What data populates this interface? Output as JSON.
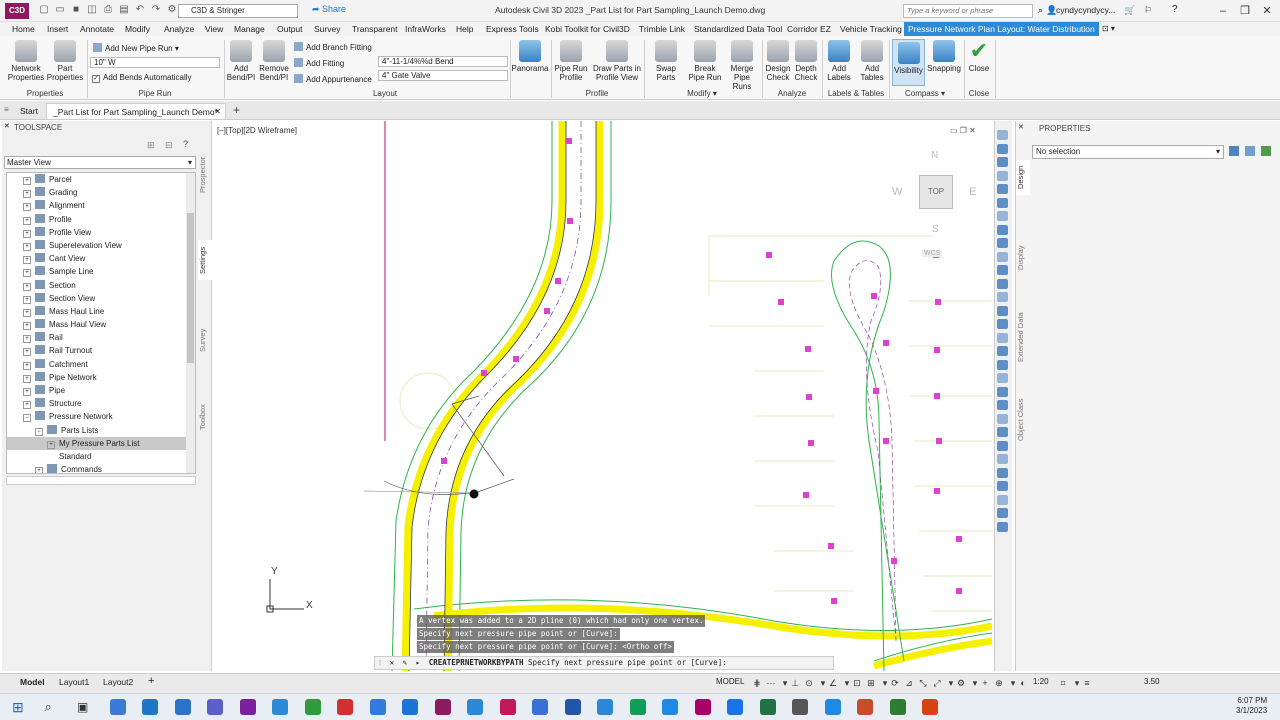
{
  "titlebar": {
    "app_badge": "C3D",
    "workspace": "C3D & Stringer",
    "share": "Share",
    "window_title": "Autodesk Civil 3D 2023   _Part List for Part Sampling_Launch Demo.dwg",
    "search_placeholder": "Type a keyword or phrase",
    "user": "cyndycyndycy...",
    "help": "?",
    "minimize": "–",
    "maximize": "❐",
    "close": "✕"
  },
  "menu_tabs": [
    "Home",
    "Insert",
    "Annotate",
    "Modify",
    "Analyze",
    "View",
    "Manage",
    "Output",
    "Survey",
    "Transparent",
    "InfraWorks",
    "Help",
    "Express Tools",
    "Kobi Toolkit for Civil3D",
    "Trimble Link",
    "Standardized Data Tool",
    "Corridor EZ",
    "Vehicle Tracking",
    "Pressure Network Plan Layout: Water Distribution"
  ],
  "ribbon": {
    "network_properties": "Network Properties",
    "part_properties": "Part Properties",
    "properties_panel": "Properties",
    "add_new_pipe_run": "Add New Pipe Run",
    "pipe_size": "10\" W",
    "add_bends_auto": "Add Bends Automatically",
    "pipe_run_panel": "Pipe Run",
    "add_bend_pi": "Add Bend/PI",
    "remove_bend_pi": "Remove Bend/PI",
    "add_branch_fitting": "Add Branch Fitting",
    "add_fitting": "Add Fitting",
    "add_appurtenance": "Add Appurtenance",
    "fitting_value": "4\"-11-1/4%%d Bend",
    "appurtenance_value": "4\" Gate Valve",
    "layout_panel": "Layout",
    "panorama": "Panorama",
    "pipe_run_profile": "Pipe Run Profile",
    "draw_parts_profile": "Draw Parts in Profile View",
    "profile_panel": "Profile",
    "swap_parts": "Swap Parts",
    "break_pipe_run": "Break Pipe Run",
    "merge_pipe_runs": "Merge Pipe Runs",
    "modify_panel": "Modify",
    "design_check": "Design Check",
    "depth_check": "Depth Check",
    "analyze_panel": "Analyze",
    "add_labels": "Add Labels",
    "add_tables": "Add Tables",
    "labels_tables_panel": "Labels & Tables",
    "visibility": "Visibility",
    "snapping": "Snapping",
    "compass_panel": "Compass",
    "close": "Close",
    "close_panel": "Close"
  },
  "doc_tabs": {
    "start": "Start",
    "active": "_Part List for Part Sampling_Launch Demo*",
    "close": "✕",
    "add": "+"
  },
  "toolspace": {
    "title": "TOOLSPACE",
    "view": "Master View",
    "items": [
      {
        "label": "Parcel",
        "indent": 1
      },
      {
        "label": "Grading",
        "indent": 1
      },
      {
        "label": "Alignment",
        "indent": 1
      },
      {
        "label": "Profile",
        "indent": 1
      },
      {
        "label": "Profile View",
        "indent": 1
      },
      {
        "label": "Superelevation View",
        "indent": 1
      },
      {
        "label": "Cant View",
        "indent": 1
      },
      {
        "label": "Sample Line",
        "indent": 1
      },
      {
        "label": "Section",
        "indent": 1
      },
      {
        "label": "Section View",
        "indent": 1
      },
      {
        "label": "Mass Haul Line",
        "indent": 1
      },
      {
        "label": "Mass Haul View",
        "indent": 1
      },
      {
        "label": "Rail",
        "indent": 1
      },
      {
        "label": "Rail Turnout",
        "indent": 1
      },
      {
        "label": "Catchment",
        "indent": 1
      },
      {
        "label": "Pipe Network",
        "indent": 1
      },
      {
        "label": "Pipe",
        "indent": 1
      },
      {
        "label": "Structure",
        "indent": 1
      },
      {
        "label": "Pressure Network",
        "indent": 1
      },
      {
        "label": "Parts Lists",
        "indent": 2
      },
      {
        "label": "My Pressure Parts List",
        "indent": 3
      },
      {
        "label": "Standard",
        "indent": 3
      },
      {
        "label": "Commands",
        "indent": 2
      }
    ],
    "side_tabs": [
      "Prospector",
      "Settings",
      "Survey",
      "Toolbox"
    ]
  },
  "viewport": {
    "label": "[–][Top][2D Wireframe]",
    "compass": {
      "n": "N",
      "s": "S",
      "e": "E",
      "w": "W",
      "top": "TOP",
      "wcs": "WCS"
    },
    "ucs_x": "X",
    "ucs_y": "Y"
  },
  "command": {
    "history": [
      "A vertex was added to a 2D pline (0) which had only one vertex.",
      "Specify next pressure pipe point or [Curve]:",
      "Specify next pressure pipe point or [Curve]:  <Ortho off>"
    ],
    "current_command": "CREATEPRNETWORKBYPATH",
    "prompt": "Specify next pressure pipe point or [Curve]:"
  },
  "properties": {
    "title": "PROPERTIES",
    "selection": "No selection",
    "side_tabs": [
      "Design",
      "Display",
      "Extended Data",
      "Object Class"
    ]
  },
  "status": {
    "layout_tabs": [
      "Model",
      "Layout1",
      "Layout2"
    ],
    "add_tab": "+",
    "model": "MODEL",
    "scale": "1:20",
    "value": "3.50"
  },
  "taskbar": {
    "time": "6:07 PM",
    "date": "3/1/2023"
  },
  "colors": {
    "ribbon_accent": "#2d8ad6",
    "road_yellow": "#f4f000",
    "lot_green": "#2db34a",
    "marker_magenta": "#e040d0"
  }
}
